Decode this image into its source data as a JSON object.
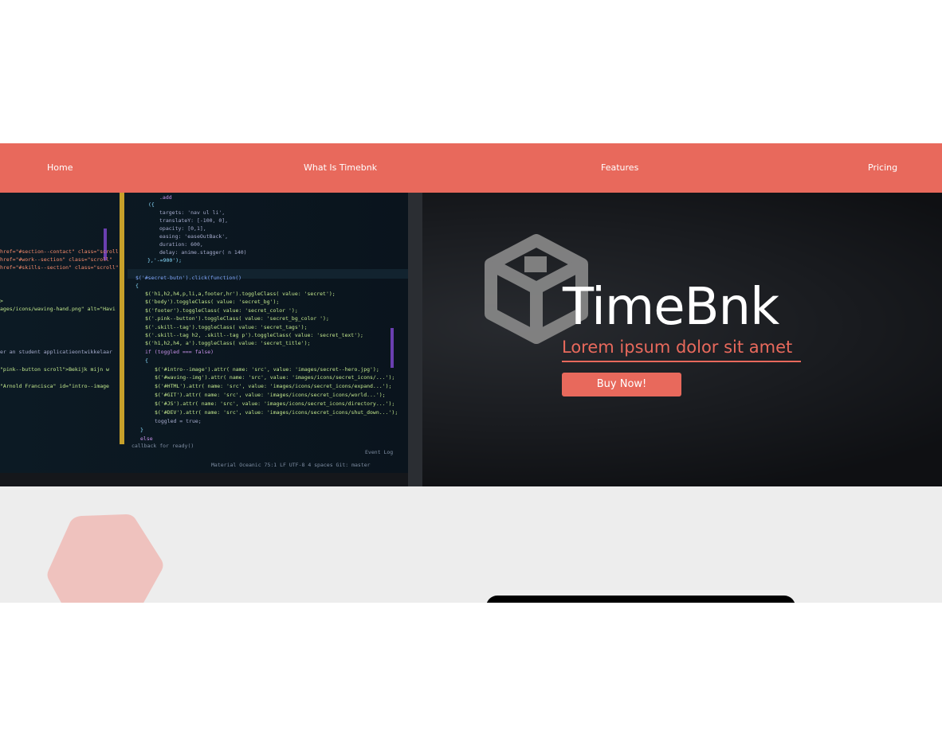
{
  "nav": {
    "items": [
      {
        "label": "Home"
      },
      {
        "label": "What Is Timebnk"
      },
      {
        "label": "Features"
      },
      {
        "label": "Pricing"
      }
    ]
  },
  "hero": {
    "logo_icon": "codepen-cube-logo",
    "title": "TimeBnk",
    "subtitle": "Lorem ipsum dolor sit amet",
    "cta_label": "Buy Now!"
  },
  "colors": {
    "accent": "#e8695c",
    "hero_overlay": "#111215",
    "section_bg": "#ededed",
    "hexagon": "#efc2be"
  }
}
